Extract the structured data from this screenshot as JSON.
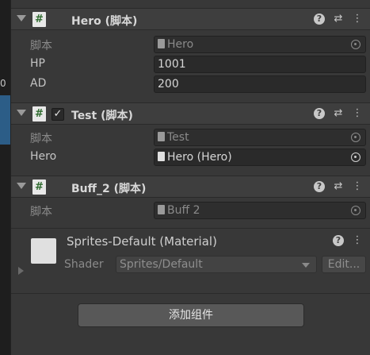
{
  "left_panel": {
    "partial_text": "0"
  },
  "components": [
    {
      "title": "Hero  (脚本)",
      "has_toggle": false,
      "fields": [
        {
          "label": "脚本",
          "value": "Hero"
        },
        {
          "label": "HP",
          "value": "1001"
        },
        {
          "label": "AD",
          "value": "200"
        }
      ]
    },
    {
      "title": "Test  (脚本)",
      "has_toggle": true,
      "toggle_checked": true,
      "fields": [
        {
          "label": "脚本",
          "value": "Test"
        },
        {
          "label": "Hero",
          "value": "Hero (Hero)"
        }
      ]
    },
    {
      "title": "Buff_2  (脚本)",
      "has_toggle": false,
      "fields": [
        {
          "label": "脚本",
          "value": "Buff 2"
        }
      ]
    }
  ],
  "material": {
    "title": "Sprites-Default (Material)",
    "shader_label": "Shader",
    "shader_value": "Sprites/Default",
    "edit_label": "Edit..."
  },
  "add_component_label": "添加组件",
  "icons": {
    "script": "#",
    "check": "✓",
    "help": "?",
    "settings": "⇄",
    "more": "⋮"
  },
  "colors": {
    "background": "#383838",
    "header": "#3e3e3e",
    "field": "#2a2a2a",
    "selection": "#2c5d87",
    "button": "#585858"
  }
}
